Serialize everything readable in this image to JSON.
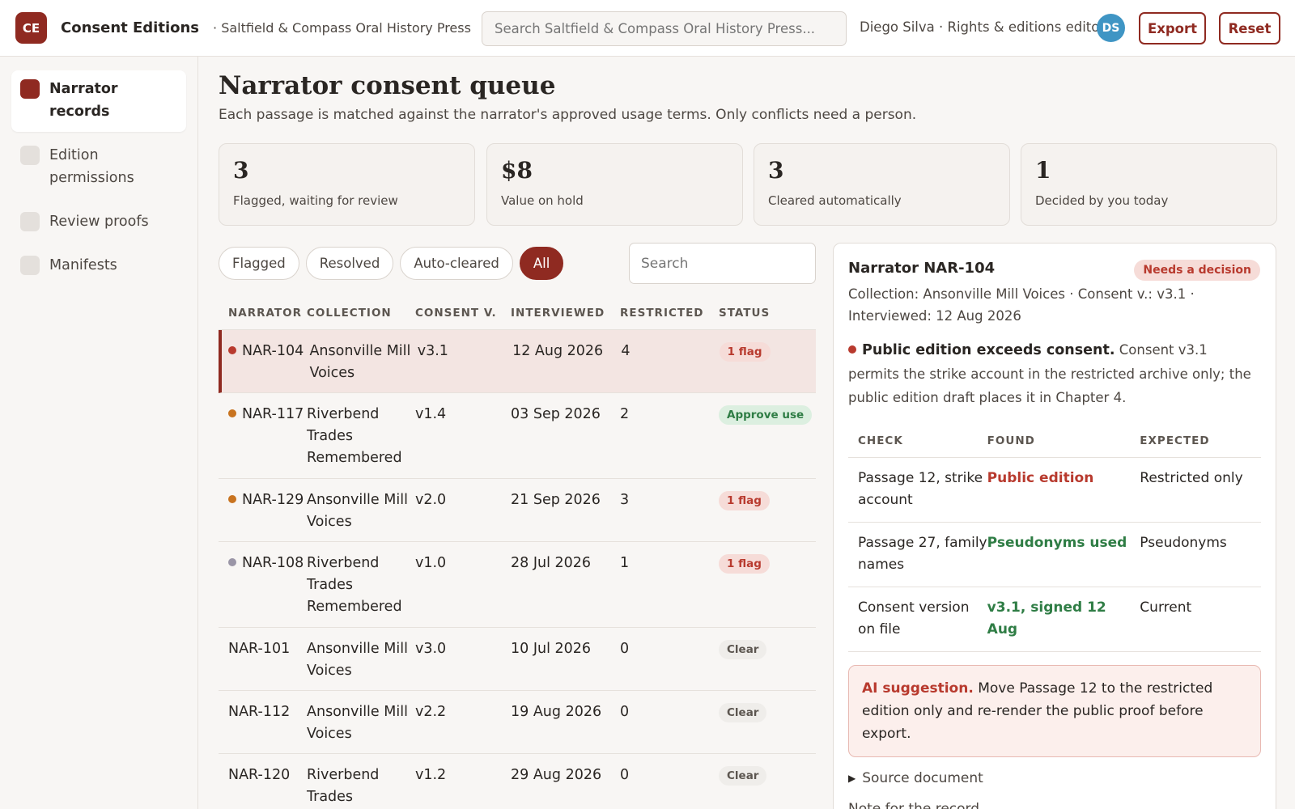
{
  "app": {
    "logo": "CE",
    "name": "Consent Editions",
    "org": "· Saltfield & Compass Oral History Press",
    "search_placeholder": "Search Saltfield & Compass Oral History Press...",
    "user": "Diego Silva · Rights & editions editor",
    "avatar": "DS",
    "export_label": "Export",
    "reset_label": "Reset"
  },
  "sidebar": {
    "items": [
      {
        "label": "Narrator records",
        "active": true
      },
      {
        "label": "Edition permissions",
        "active": false
      },
      {
        "label": "Review proofs",
        "active": false
      },
      {
        "label": "Manifests",
        "active": false
      }
    ]
  },
  "page": {
    "title": "Narrator consent queue",
    "subtitle": "Each passage is matched against the narrator's approved usage terms. Only conflicts need a person."
  },
  "stats": [
    {
      "value": "3",
      "label": "Flagged, waiting for review"
    },
    {
      "value": "$8",
      "label": "Value on hold"
    },
    {
      "value": "3",
      "label": "Cleared automatically"
    },
    {
      "value": "1",
      "label": "Decided by you today"
    }
  ],
  "filters": {
    "chips": [
      "Flagged",
      "Resolved",
      "Auto-cleared",
      "All"
    ],
    "active": "All",
    "search_placeholder": "Search"
  },
  "table": {
    "headers": [
      "NARRATOR",
      "COLLECTION",
      "CONSENT V.",
      "INTERVIEWED",
      "RESTRICTED",
      "STATUS"
    ],
    "rows": [
      {
        "narrator": "NAR-104",
        "collection": "Ansonville Mill Voices",
        "version": "v3.1",
        "interviewed": "12 Aug 2026",
        "restricted": "4",
        "status": "1 flag",
        "status_kind": "flag",
        "dot": "#b83a2e",
        "selected": true
      },
      {
        "narrator": "NAR-117",
        "collection": "Riverbend Trades Remembered",
        "version": "v1.4",
        "interviewed": "03 Sep 2026",
        "restricted": "2",
        "status": "Approve use",
        "status_kind": "approve",
        "dot": "#c8731f",
        "selected": false
      },
      {
        "narrator": "NAR-129",
        "collection": "Ansonville Mill Voices",
        "version": "v2.0",
        "interviewed": "21 Sep 2026",
        "restricted": "3",
        "status": "1 flag",
        "status_kind": "flag",
        "dot": "#c8731f",
        "selected": false
      },
      {
        "narrator": "NAR-108",
        "collection": "Riverbend Trades Remembered",
        "version": "v1.0",
        "interviewed": "28 Jul 2026",
        "restricted": "1",
        "status": "1 flag",
        "status_kind": "flag",
        "dot": "#9a95a6",
        "selected": false
      },
      {
        "narrator": "NAR-101",
        "collection": "Ansonville Mill Voices",
        "version": "v3.0",
        "interviewed": "10 Jul 2026",
        "restricted": "0",
        "status": "Clear",
        "status_kind": "clear",
        "dot": "",
        "selected": false
      },
      {
        "narrator": "NAR-112",
        "collection": "Ansonville Mill Voices",
        "version": "v2.2",
        "interviewed": "19 Aug 2026",
        "restricted": "0",
        "status": "Clear",
        "status_kind": "clear",
        "dot": "",
        "selected": false
      },
      {
        "narrator": "NAR-120",
        "collection": "Riverbend Trades",
        "version": "v1.2",
        "interviewed": "29 Aug 2026",
        "restricted": "0",
        "status": "Clear",
        "status_kind": "clear",
        "dot": "",
        "selected": false
      }
    ]
  },
  "detail": {
    "title": "Narrator NAR-104",
    "badge": "Needs a decision",
    "meta": "Collection: Ansonville Mill Voices · Consent v.: v3.1 · Interviewed: 12 Aug 2026",
    "issue_title": "Public edition exceeds consent.",
    "issue_text": "Consent v3.1 permits the strike account in the restricted archive only; the public edition draft places it in Chapter 4.",
    "check_headers": [
      "CHECK",
      "FOUND",
      "EXPECTED"
    ],
    "checks": [
      {
        "check": "Passage 12, strike account",
        "found": "Public edition",
        "found_ok": false,
        "expected": "Restricted only"
      },
      {
        "check": "Passage 27, family names",
        "found": "Pseudonyms used",
        "found_ok": true,
        "expected": "Pseudonyms"
      },
      {
        "check": "Consent version on file",
        "found": "v3.1, signed 12 Aug",
        "found_ok": true,
        "expected": "Current"
      }
    ],
    "ai_title": "AI suggestion.",
    "ai_text": "Move Passage 12 to the restricted edition only and re-render the public proof before export.",
    "source_label": "Source document",
    "note_label": "Note for the record"
  },
  "colors": {
    "accent": "#8f2a21",
    "flag": "#b83a2e",
    "approve": "#2f7d45",
    "avatar": "#3f95c4"
  }
}
